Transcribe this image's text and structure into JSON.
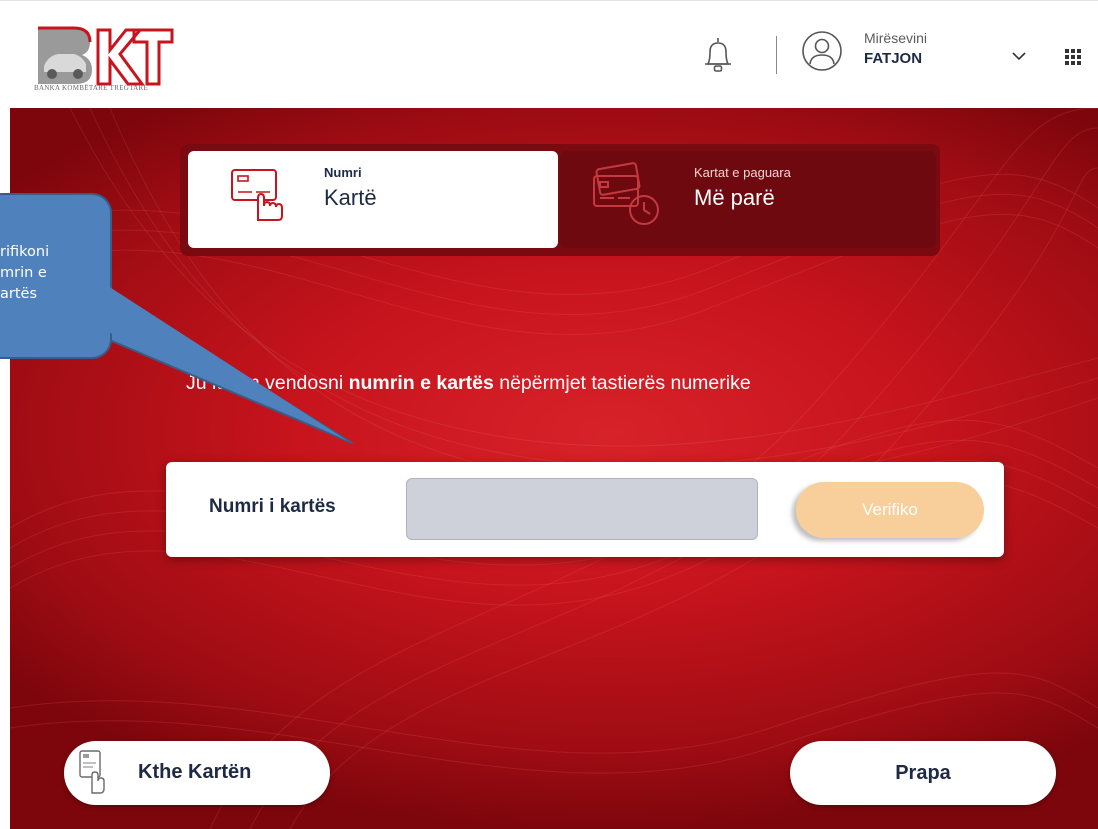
{
  "header": {
    "logo_text": "BKT",
    "logo_tagline": "BANKA KOMBËTARE TREGTARE",
    "greeting": "Mirësevini",
    "user_name": "FATJON"
  },
  "tabs": [
    {
      "small": "Numri",
      "big": "Kartë",
      "active": true
    },
    {
      "small": "Kartat e paguara",
      "big": "Më parë",
      "active": false
    }
  ],
  "callout": {
    "lines": [
      "rifikoni",
      "mrin e",
      "artës"
    ]
  },
  "instruction": {
    "part1": "Ju lutem vendosni ",
    "bold": "numrin e kartës",
    "part2": " nëpërmjet tastierës numerike"
  },
  "card_form": {
    "label": "Numri i kartës",
    "input_value": "",
    "verify_label": "Verifiko"
  },
  "buttons": {
    "return_card": "Kthe Kartën",
    "back": "Prapa"
  },
  "colors": {
    "brand_red": "#c8141d",
    "navy": "#1e2a44",
    "verify_disabled": "#f8cf9a",
    "callout_blue": "#4f81bd"
  }
}
